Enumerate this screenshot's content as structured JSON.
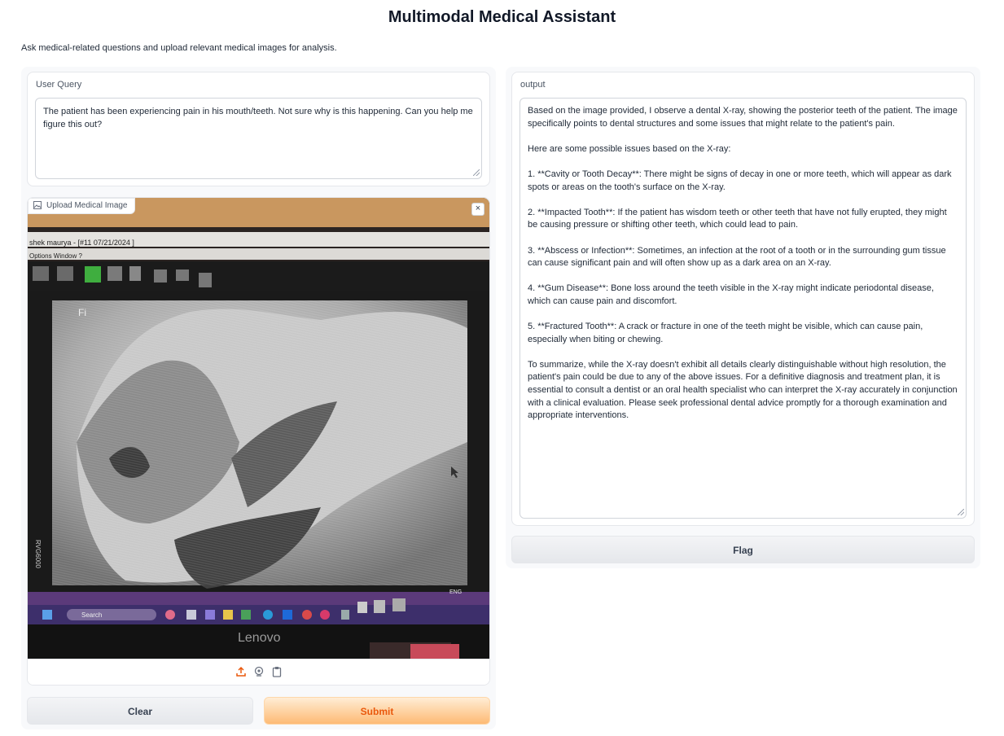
{
  "app": {
    "title": "Multimodal Medical Assistant",
    "description": "Ask medical-related questions and upload relevant medical images for analysis."
  },
  "query": {
    "label": "User Query",
    "value": "The patient has been experiencing pain in his mouth/teeth. Not sure why is this happening. Can you help me figure this out?"
  },
  "image_upload": {
    "label": "Upload Medical Image",
    "close_glyph": "×",
    "photo": {
      "window_title": "shek maurya - [#11 07/21/2024 ]",
      "menu": [
        "Options",
        "Window",
        "?"
      ],
      "monitor_brand": "Lenovo",
      "taskbar_search": "Search",
      "side_label": "RVG6000",
      "lang": "ENG\nIN"
    },
    "toolbar_icons": [
      "upload-icon",
      "webcam-icon",
      "clipboard-icon"
    ]
  },
  "buttons": {
    "clear": "Clear",
    "submit": "Submit",
    "flag": "Flag"
  },
  "output": {
    "label": "output",
    "value": "Based on the image provided, I observe a dental X-ray, showing the posterior teeth of the patient. The image specifically points to dental structures and some issues that might relate to the patient's pain.\n\nHere are some possible issues based on the X-ray:\n\n1. **Cavity or Tooth Decay**: There might be signs of decay in one or more teeth, which will appear as dark spots or areas on the tooth's surface on the X-ray.\n\n2. **Impacted Tooth**: If the patient has wisdom teeth or other teeth that have not fully erupted, they might be causing pressure or shifting other teeth, which could lead to pain.\n\n3. **Abscess or Infection**: Sometimes, an infection at the root of a tooth or in the surrounding gum tissue can cause significant pain and will often show up as a dark area on an X-ray.\n\n4. **Gum Disease**: Bone loss around the teeth visible in the X-ray might indicate periodontal disease, which can cause pain and discomfort.\n\n5. **Fractured Tooth**: A crack or fracture in one of the teeth might be visible, which can cause pain, especially when biting or chewing.\n\nTo summarize, while the X-ray doesn't exhibit all details clearly distinguishable without high resolution, the patient's pain could be due to any of the above issues. For a definitive diagnosis and treatment plan, it is essential to consult a dentist or an oral health specialist who can interpret the X-ray accurately in conjunction with a clinical evaluation. Please seek professional dental advice promptly for a thorough examination and appropriate interventions."
  },
  "colors": {
    "accent": "#ea580c",
    "panel_bg": "#f8f9fb",
    "border": "#e5e7eb"
  }
}
